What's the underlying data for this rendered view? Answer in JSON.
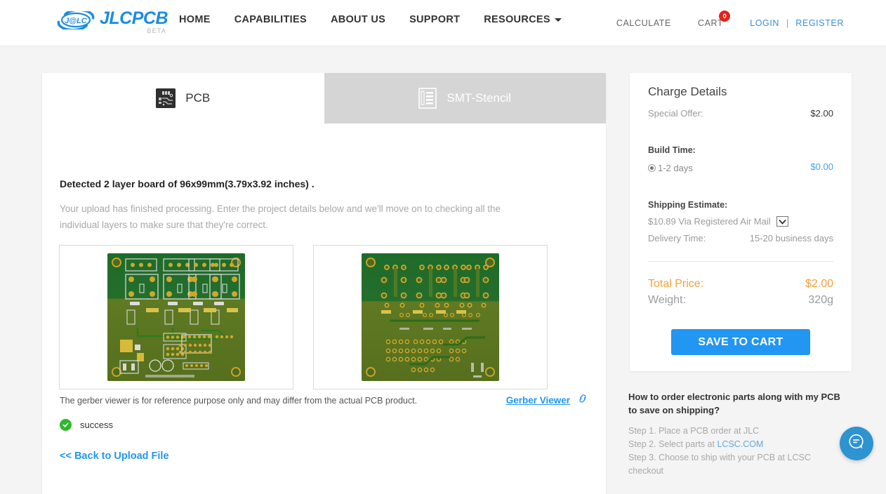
{
  "header": {
    "logo_word": "JLCPCB",
    "logo_mark_text": "J@LC",
    "logo_beta": "BETA",
    "nav": [
      {
        "label": "HOME",
        "has_caret": false
      },
      {
        "label": "CAPABILITIES",
        "has_caret": false
      },
      {
        "label": "ABOUT US",
        "has_caret": false
      },
      {
        "label": "SUPPORT",
        "has_caret": false
      },
      {
        "label": "RESOURCES",
        "has_caret": true
      }
    ],
    "calculate_label": "CALCULATE",
    "cart_label": "CART",
    "cart_count": "0",
    "login_label": "LOGIN",
    "auth_separator": "|",
    "register_label": "REGISTER",
    "cart_badge_color": "#e2231a",
    "link_color": "#3b8fd4"
  },
  "tabs": [
    {
      "label": "PCB",
      "icon": "pcb-board-icon",
      "active": true
    },
    {
      "label": "SMT-Stencil",
      "icon": "stencil-icon",
      "active": false
    }
  ],
  "main": {
    "detected_text": "Detected 2 layer board of 96x99mm(3.79x3.92 inches) .",
    "processing_note": "Your upload has finished processing. Enter the project details below and we'll move on to checking all the individual layers to make sure that they're correct.",
    "viewer_note": "The gerber viewer is for reference purpose only and may differ from the actual PCB product.",
    "gerber_viewer_label": "Gerber Viewer",
    "status_text": "success",
    "back_link_label": "<< Back to Upload File",
    "preview_top_alt": "pcb-top-layer-render",
    "preview_bottom_alt": "pcb-bottom-layer-render"
  },
  "charge_details": {
    "title": "Charge Details",
    "special_offer_label": "Special Offer:",
    "special_offer_value": "$2.00",
    "build_time_label": "Build Time:",
    "build_time_option": "1-2 days",
    "build_time_price": "$0.00",
    "shipping_estimate_label": "Shipping Estimate:",
    "shipping_value": "$10.89 Via  Registered Air Mail",
    "delivery_time_label": "Delivery Time:",
    "delivery_time_value": "15-20 business days",
    "total_price_label": "Total Price:",
    "total_price_value": "$2.00",
    "weight_label": "Weight:",
    "weight_value": "320g",
    "save_button_label": "SAVE TO CART",
    "accent_orange": "#f0a13c",
    "accent_blue": "#2196f3"
  },
  "help": {
    "title": "How to order electronic parts along with my PCB to save on shipping?",
    "step1": "Step 1. Place a PCB order at JLC",
    "step2_prefix": "Step 2. Select parts at ",
    "step2_link": "LCSC.COM",
    "step3": "Step 3. Choose to ship with your PCB at LCSC checkout"
  },
  "chat": {
    "icon": "chat-bubble-icon"
  }
}
